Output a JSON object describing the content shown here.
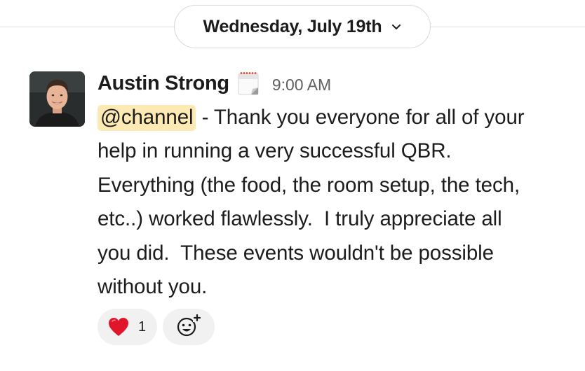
{
  "date_divider": {
    "label": "Wednesday, July 19th",
    "chevron_icon": "chevron-down-icon"
  },
  "message": {
    "author": "Austin Strong",
    "status_icon": "calendar-icon",
    "timestamp": "9:00 AM",
    "mention": "@channel",
    "body_lines": [
      " - Thank you everyone for all of your",
      "help in running a very successful QBR.",
      "Everything (the food, the room setup, the tech,",
      "etc..) worked flawlessly.  I truly appreciate all",
      "you did.  These events wouldn't be possible",
      "without you."
    ]
  },
  "reactions": [
    {
      "emoji": "❤️",
      "icon": "red-heart-icon",
      "count": "1"
    }
  ],
  "add_reaction_icon": "add-reaction-icon",
  "colors": {
    "mention_bg": "#fce9b3",
    "reaction_bg": "#f1f1f1",
    "timestamp": "#616061",
    "text": "#1d1c1d"
  }
}
